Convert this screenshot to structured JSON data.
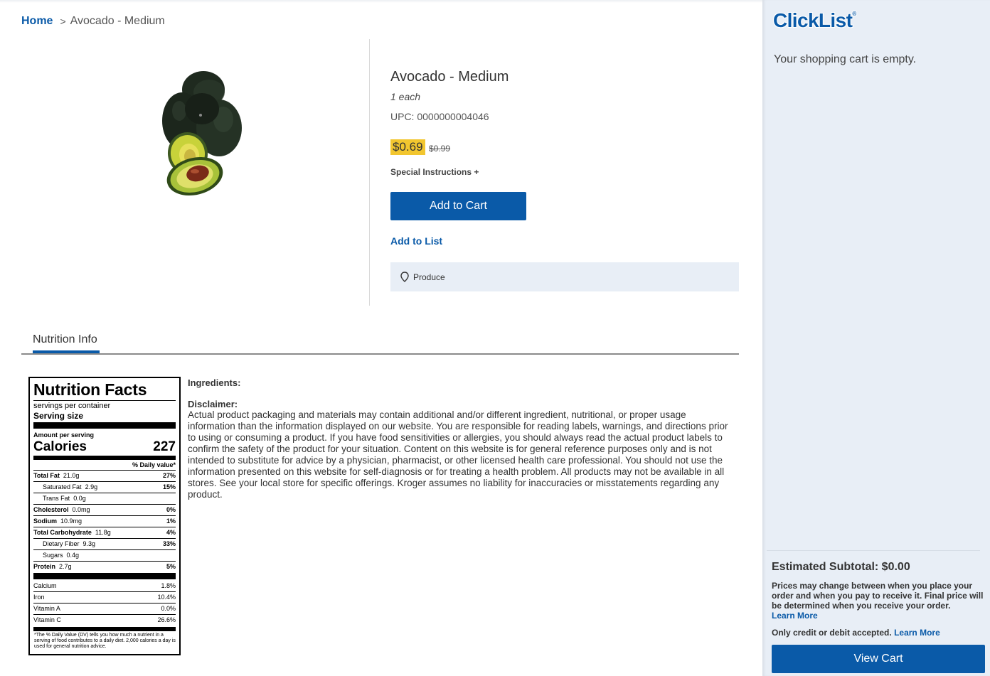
{
  "breadcrumb": {
    "home": "Home",
    "separator": ">",
    "current": "Avocado - Medium"
  },
  "product": {
    "title": "Avocado - Medium",
    "size": "1 each",
    "upc": "UPC: 0000000004046",
    "price": "$0.69",
    "old_price": "$0.99",
    "special_instructions": "Special Instructions +",
    "add_to_cart": "Add to Cart",
    "add_to_list": "Add to List",
    "location": "Produce",
    "image_icon": "avocado-image"
  },
  "tabs": {
    "nutrition": "Nutrition Info"
  },
  "nutrition": {
    "title": "Nutrition Facts",
    "servings": "servings per container",
    "serving_size": "Serving size",
    "amount_per_serving": "Amount per serving",
    "calories_label": "Calories",
    "calories_value": "227",
    "dv_header": "% Daily value*",
    "rows": [
      {
        "label": "Total Fat",
        "amount": "21.0g",
        "pct": "27%"
      },
      {
        "label": "Saturated Fat",
        "amount": "2.9g",
        "pct": "15%"
      },
      {
        "label": "Trans Fat",
        "amount": "0.0g",
        "pct": ""
      },
      {
        "label": "Cholesterol",
        "amount": "0.0mg",
        "pct": "0%"
      },
      {
        "label": "Sodium",
        "amount": "10.9mg",
        "pct": "1%"
      },
      {
        "label": "Total Carbohydrate",
        "amount": "11.8g",
        "pct": "4%"
      },
      {
        "label": "Dietary Fiber",
        "amount": "9.3g",
        "pct": "33%"
      },
      {
        "label": "Sugars",
        "amount": "0.4g",
        "pct": ""
      },
      {
        "label": "Protein",
        "amount": "2.7g",
        "pct": "5%"
      }
    ],
    "vitamins": [
      {
        "label": "Calcium",
        "pct": "1.8%"
      },
      {
        "label": "Iron",
        "pct": "10.4%"
      },
      {
        "label": "Vitamin A",
        "pct": "0.0%"
      },
      {
        "label": "Vitamin C",
        "pct": "26.6%"
      }
    ],
    "footnote": "*The % Daily Value (DV) tells you how much a nutrient in a serving of food contributes to a daily diet. 2,000 calories a day is used for general nutrition advice."
  },
  "info": {
    "ingredients_heading": "Ingredients:",
    "disclaimer_heading": "Disclaimer:",
    "disclaimer_text": "Actual product packaging and materials may contain additional and/or different ingredient, nutritional, or proper usage information than the information displayed on our website. You are responsible for reading labels, warnings, and directions prior to using or consuming a product. If you have food sensitivities or allergies, you should always read the actual product labels to confirm the safety of the product for your situation. Content on this website is for general reference purposes only and is not intended to substitute for advice by a physician, pharmacist, or other licensed health care professional. You should not use the information presented on this website for self-diagnosis or for treating a health problem. All products may not be available in all stores. See your local store for specific offerings. Kroger assumes no liability for inaccuracies or misstatements regarding any product."
  },
  "sidebar": {
    "logo": "ClickList",
    "logo_mark": "®",
    "cart_empty": "Your shopping cart is empty.",
    "subtotal": "Estimated Subtotal: $0.00",
    "prices_note": "Prices may change between when you place your order and when you pay to receive it. Final price will be determined when you receive your order.",
    "learn_more_1": "Learn More",
    "credit_note": "Only credit or debit accepted.",
    "learn_more_2": "Learn More",
    "view_cart": "View Cart"
  },
  "colors": {
    "brand_blue": "#0a5aa8",
    "price_highlight": "#f2c62f",
    "sidebar_bg": "#e8eef6"
  }
}
